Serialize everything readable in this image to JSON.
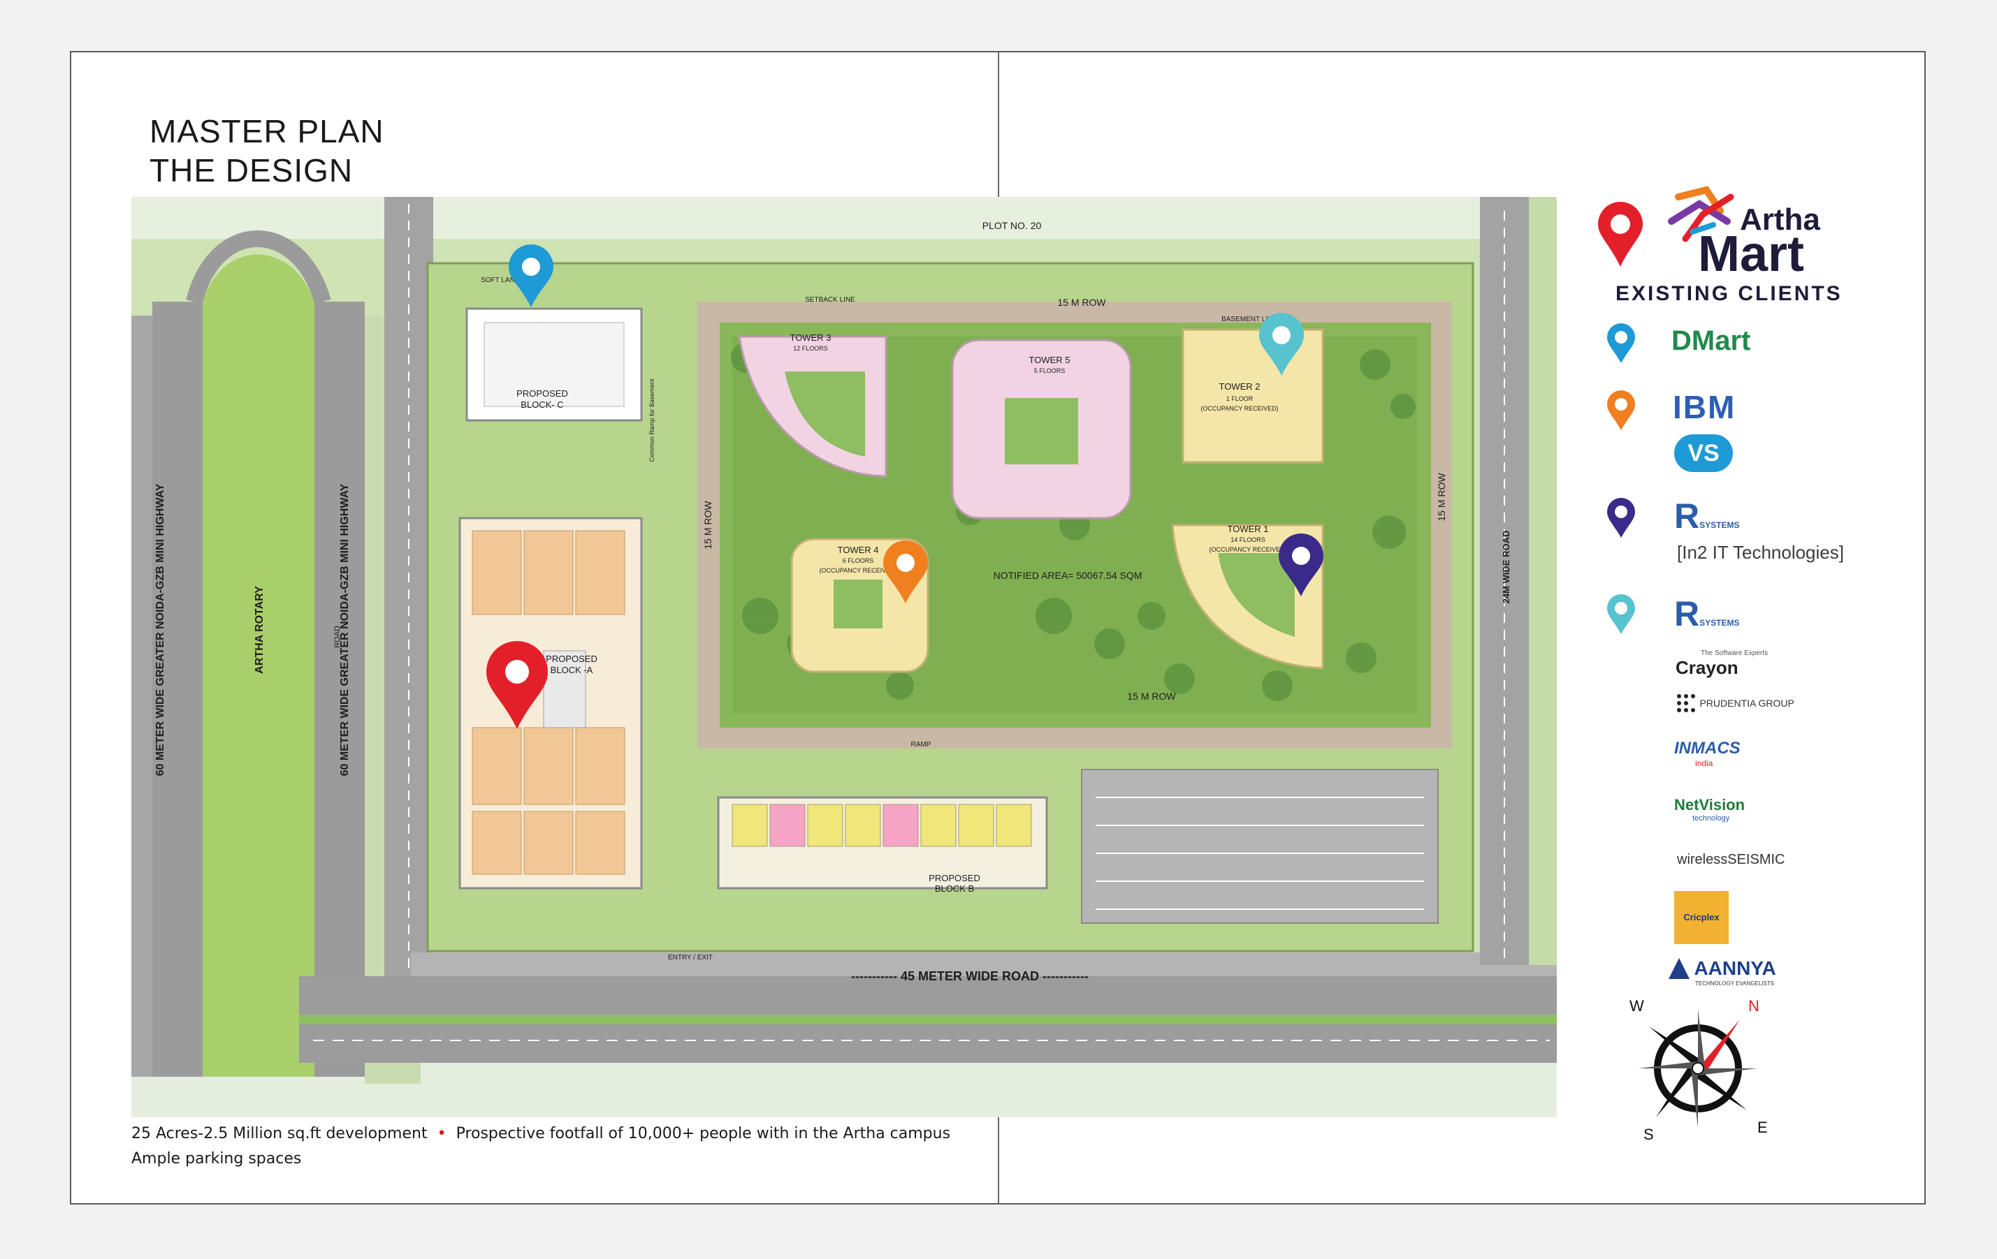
{
  "title": {
    "line1": "MASTER PLAN",
    "line2": "THE DESIGN"
  },
  "colors": {
    "pin_red": "#e3202a",
    "pin_blue": "#1e9ad6",
    "pin_orange": "#f07f1f",
    "pin_purple": "#3a2a8a",
    "pin_teal": "#56c3cf",
    "grass": "#8fc25a",
    "road": "#9a9a9a",
    "tower_pink": "#f2d3e3",
    "tower_yellow": "#f4e6a8"
  },
  "map": {
    "plot": "PLOT NO. 20",
    "landscape": "SOFT LANDSCAPE",
    "row_top": "15  M  ROW",
    "row_bottom": "15  M  ROW",
    "row_left": "15  M  ROW",
    "row_right": "15  M  ROW",
    "setback": "SETBACK LINE",
    "basement": "BASEMENT LINE",
    "ramp_basement": "Common Ramp for Basement",
    "ramp": "RAMP",
    "road_left_1": "60 METER WIDE GREATER NOIDA-GZB MINI HIGHWAY",
    "road_left_2": "60 METER WIDE GREATER NOIDA-GZB MINI HIGHWAY",
    "rotary": "ARTHA ROTARY",
    "road_small": "ROAD",
    "road_bottom": "----------- 45 METER WIDE ROAD -----------",
    "road_right": "24M WIDE ROAD",
    "notified": "NOTIFIED AREA= 50067.54 SQM",
    "entry": "ENTRY / EXIT",
    "block_c": {
      "line1": "PROPOSED",
      "line2": "BLOCK- C"
    },
    "block_a": {
      "line1": "PROPOSED",
      "line2": "BLOCK -A"
    },
    "block_b": {
      "line1": "PROPOSED",
      "line2": "BLOCK B"
    },
    "tower3": {
      "name": "TOWER 3",
      "floors": "12 FLOORS"
    },
    "tower5": {
      "name": "TOWER 5",
      "floors": "5 FLOORS"
    },
    "tower2": {
      "name": "TOWER 2",
      "floors": "1 FLOOR",
      "status": "(OCCUPANCY RECEIVED)"
    },
    "tower4": {
      "name": "TOWER 4",
      "floors": "6 FLOORS",
      "status": "(OCCUPANCY RECEIVED)"
    },
    "tower1": {
      "name": "TOWER 1",
      "floors": "14 FLOORS",
      "status": "(OCCUPANCY RECEIVED)"
    }
  },
  "footer": {
    "fact1": "25 Acres-2.5 Million sq.ft development",
    "fact2": "Prospective footfall of 10,000+ people with in the Artha campus",
    "fact3": "Ample parking spaces"
  },
  "brand": {
    "name1": "Artha",
    "name2": "Mart",
    "subtitle": "EXISTING CLIENTS"
  },
  "clients": {
    "dmart": "DMart",
    "ibm": "IBM",
    "vs": "VS",
    "r1": "R",
    "r1_small": "SYSTEMS",
    "in2it": "[In2 IT Technologies]",
    "r2": "R",
    "r2_small": "SYSTEMS",
    "crayon": "Crayon",
    "crayon_tag": "The Software Experts",
    "prudentia": "PRUDENTIA GROUP",
    "inmacs": "INMACS",
    "inmacs_sub": "india",
    "netvision": "NetVision",
    "netvision_sub": "technology",
    "wireless": "wirelessSEISMIC",
    "cricplex": "Cricplex",
    "aannya": "AANNYA",
    "aannya_sub": "TECHNOLOGY EVANGELISTS"
  },
  "compass": {
    "n": "N",
    "e": "E",
    "s": "S",
    "w": "W"
  }
}
